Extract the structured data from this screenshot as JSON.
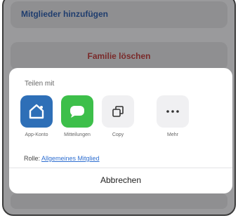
{
  "background": {
    "add_members_label": "Mitglieder hinzufügen",
    "delete_family_label": "Familie löschen"
  },
  "share_sheet": {
    "title": "Teilen mit",
    "apps": [
      {
        "label": "App-Konto",
        "icon": "house-icon",
        "color": "#2e6fb7"
      },
      {
        "label": "Mitteilungen",
        "icon": "message-bubble-icon",
        "color": "#3dbf4a"
      },
      {
        "label": "Copy",
        "icon": "copy-icon"
      },
      {
        "label": "Mehr",
        "icon": "more-dots-icon"
      }
    ],
    "role_label": "Rolle:",
    "role_value": "Allgemeines Mitglied",
    "cancel_label": "Abbrechen"
  }
}
